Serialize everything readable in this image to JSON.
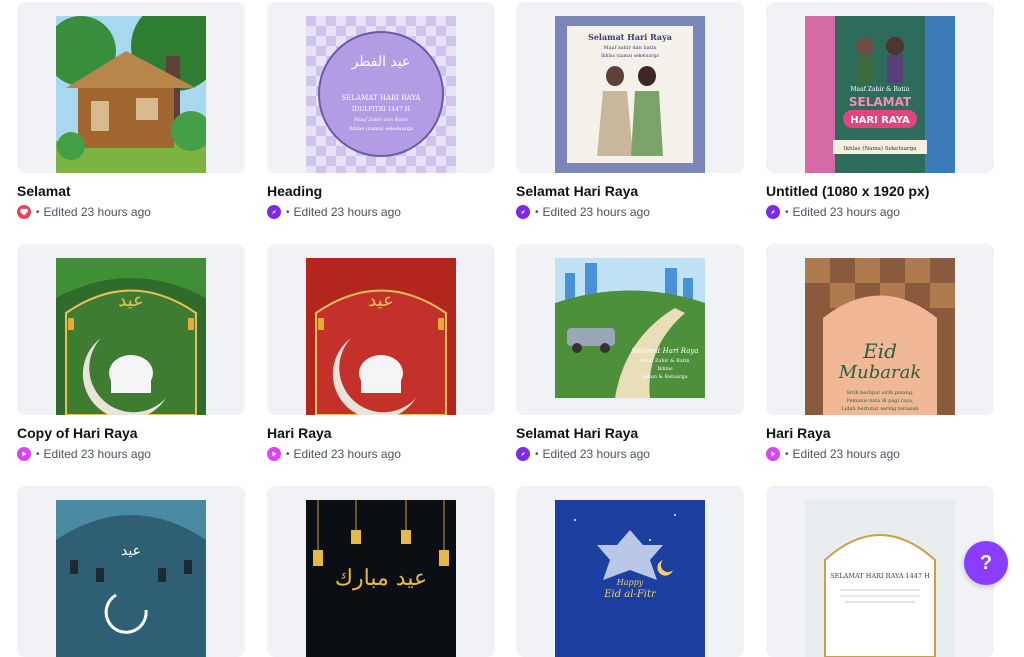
{
  "designs": [
    {
      "title": "Selamat",
      "edited": "Edited 23 hours ago",
      "type_icon": "heart-icon",
      "type_color": "#e8435a"
    },
    {
      "title": "Heading",
      "edited": "Edited 23 hours ago",
      "type_icon": "compass-icon",
      "type_color": "#7d2ae8"
    },
    {
      "title": "Selamat Hari Raya",
      "edited": "Edited 23 hours ago",
      "type_icon": "compass-icon",
      "type_color": "#7d2ae8"
    },
    {
      "title": "Untitled (1080 x 1920 px)",
      "edited": "Edited 23 hours ago",
      "type_icon": "compass-icon",
      "type_color": "#7d2ae8"
    },
    {
      "title": "Copy of Hari Raya",
      "edited": "Edited 23 hours ago",
      "type_icon": "play-icon",
      "type_color": "#d946ef"
    },
    {
      "title": "Hari Raya",
      "edited": "Edited 23 hours ago",
      "type_icon": "play-icon",
      "type_color": "#d946ef"
    },
    {
      "title": "Selamat Hari Raya",
      "edited": "Edited 23 hours ago",
      "type_icon": "compass-icon",
      "type_color": "#7d2ae8"
    },
    {
      "title": "Hari Raya",
      "edited": "Edited 23 hours ago",
      "type_icon": "play-icon",
      "type_color": "#d946ef"
    }
  ],
  "thumb_text": {
    "heading_card": [
      "SELAMAT HARI RAYA",
      "IDULFITRI 1447 H",
      "Maaf Zahir dan Batin",
      "Ikhlas (nama) sekeluarga"
    ],
    "selamat_card": [
      "Selamat Hari Raya",
      "Maaf zahir dan batin",
      "Ikhlas (nama) sekeluarga"
    ],
    "untitled_card": [
      "Maaf Zahir & Batin",
      "SELAMAT",
      "HARI RAYA",
      "Ikhlas (Nama) Sekeluarga"
    ],
    "car_card": [
      "Selamat Hari Raya",
      "Maaf Zahir & Batin",
      "Ikhlas",
      "Adam & Keluarga"
    ],
    "eid_card": [
      "Eid",
      "Mubarak",
      "Sirih berlipat sirih pinang,",
      "Pemanis kata di pagi raya,",
      "Lidah bertutur sering tersalah"
    ],
    "last_card": [
      "SELAMAT HARI RAYA 1447 H"
    ],
    "fitr_card": [
      "Happy",
      "Eid al-Fitr"
    ]
  },
  "help": {
    "label": "?"
  },
  "colors": {
    "accent": "#8b3dff",
    "card_bg": "#f1f2f5"
  }
}
